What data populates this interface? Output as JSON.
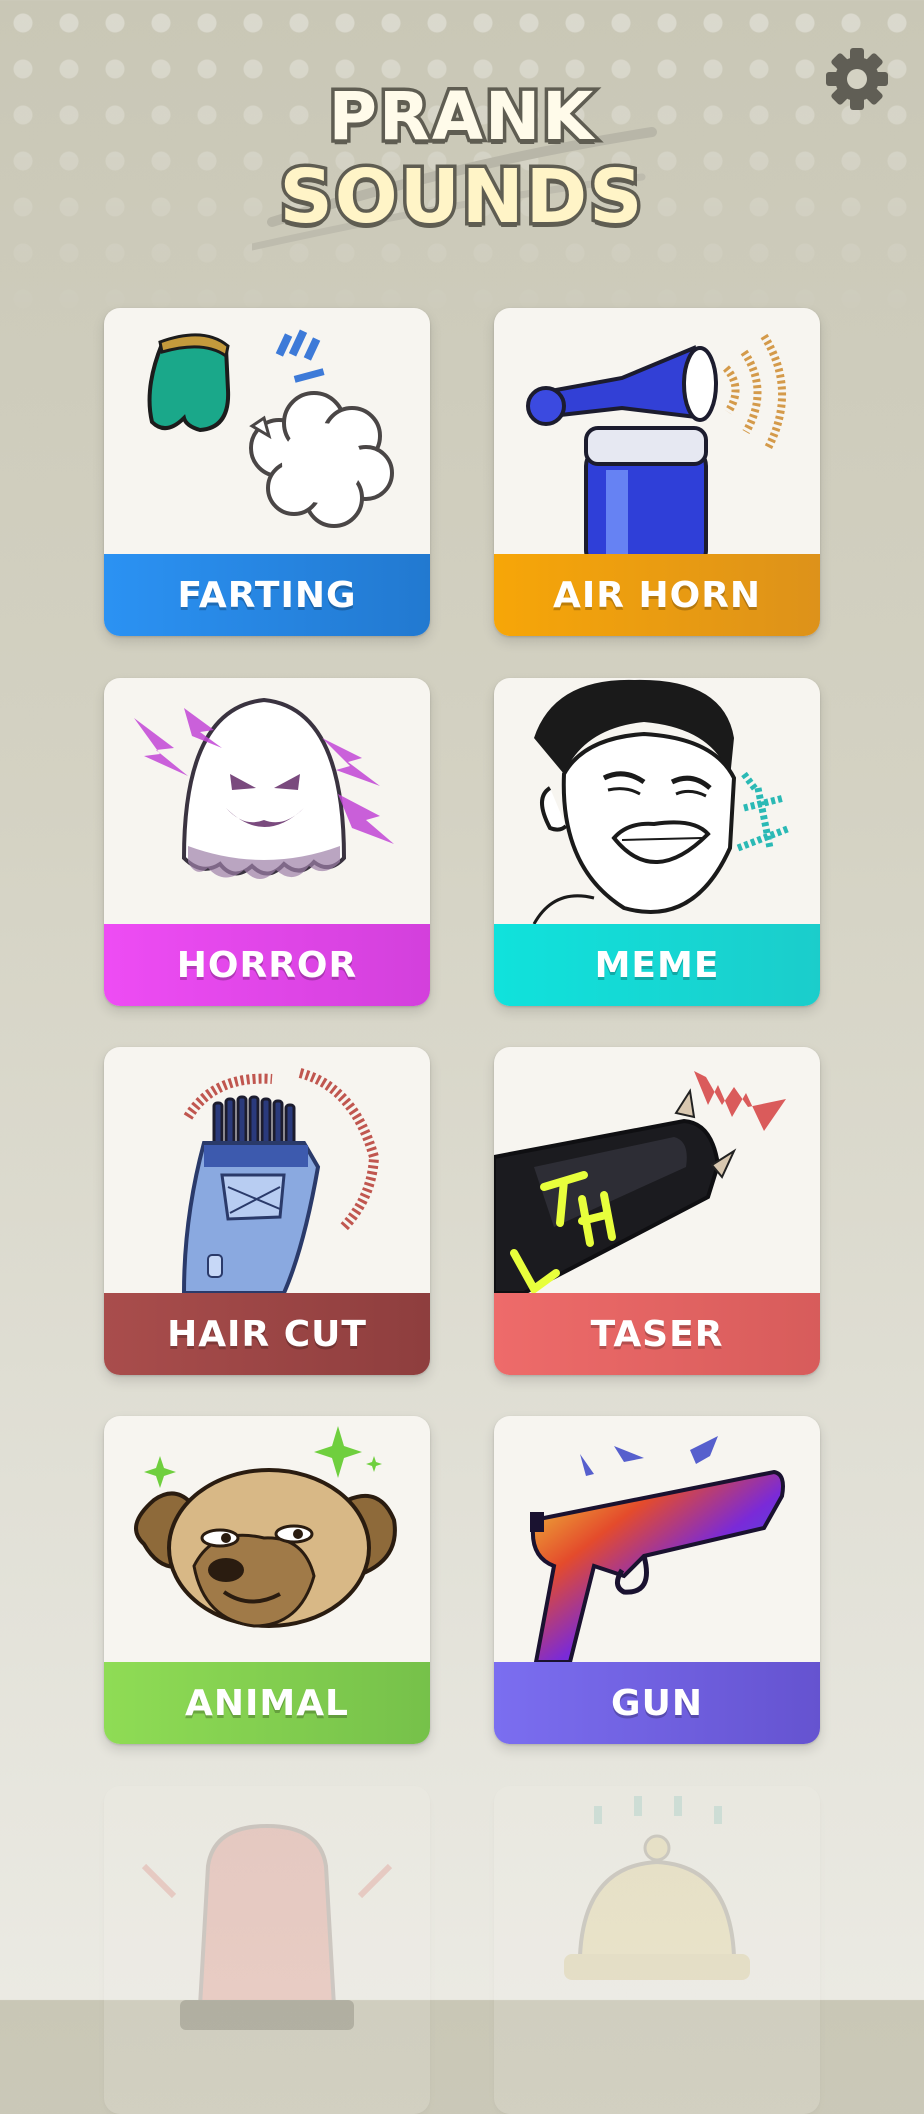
{
  "app": {
    "logo_line1": "PRANK",
    "logo_line2": "SOUNDS",
    "settings_icon": "gear-icon"
  },
  "colors": {
    "farting": "#2a8cef",
    "air_horn": "#f2a20f",
    "horror": "#e447ea",
    "meme": "#17dcd6",
    "hair_cut": "#a84b4a",
    "taser": "#ea6665",
    "animal": "#84d04e",
    "gun": "#7665e2"
  },
  "categories": [
    {
      "label": "FARTING",
      "icon": "fart-cloud-icon"
    },
    {
      "label": "AIR HORN",
      "icon": "air-horn-icon"
    },
    {
      "label": "HORROR",
      "icon": "ghost-icon"
    },
    {
      "label": "MEME",
      "icon": "meme-face-icon"
    },
    {
      "label": "HAIR CUT",
      "icon": "hair-clipper-icon"
    },
    {
      "label": "TASER",
      "icon": "taser-icon"
    },
    {
      "label": "ANIMAL",
      "icon": "dog-icon"
    },
    {
      "label": "GUN",
      "icon": "pistol-icon"
    }
  ],
  "faded_categories": [
    {
      "icon": "siren-icon"
    },
    {
      "icon": "service-bell-icon"
    }
  ]
}
